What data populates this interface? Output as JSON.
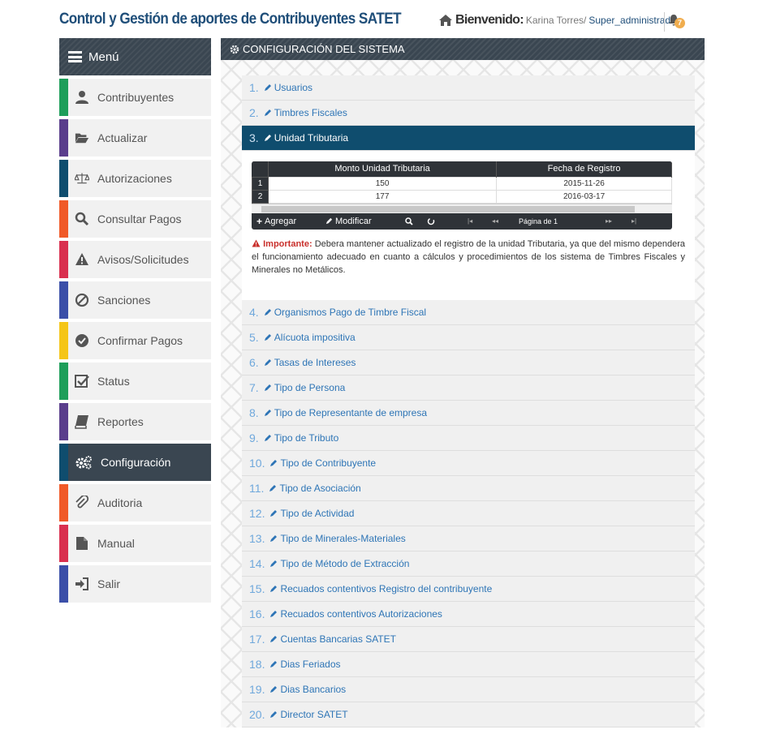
{
  "header": {
    "title": "Control y Gestión de aportes de Contribuyentes SATET",
    "welcome": "Bienvenido:",
    "user_name": "Karina Torres/",
    "role": "Super_administrador",
    "notification_count": "7"
  },
  "sidebar": {
    "menu_label": "Menú",
    "items": [
      {
        "label": "Contribuyentes",
        "color": "#1e9e5a",
        "icon": "user-icon"
      },
      {
        "label": "Actualizar",
        "color": "#5a3e8c",
        "icon": "folder-open-icon"
      },
      {
        "label": "Autorizaciones",
        "color": "#0f4d6e",
        "icon": "balance-scale-icon"
      },
      {
        "label": "Consultar Pagos",
        "color": "#f05a28",
        "icon": "search-icon"
      },
      {
        "label": "Avisos/Solicitudes",
        "color": "#d9304f",
        "icon": "warning-icon"
      },
      {
        "label": "Sanciones",
        "color": "#3b4fa8",
        "icon": "ban-icon"
      },
      {
        "label": "Confirmar Pagos",
        "color": "#f5c518",
        "icon": "check-circle-icon"
      },
      {
        "label": "Status",
        "color": "#1e9e5a",
        "icon": "check-square-icon"
      },
      {
        "label": "Reportes",
        "color": "#5a3e8c",
        "icon": "book-icon"
      },
      {
        "label": "Configuración",
        "color": "#0f4d6e",
        "icon": "cogs-icon",
        "active": true
      },
      {
        "label": "Auditoria",
        "color": "#f05a28",
        "icon": "paperclip-icon"
      },
      {
        "label": "Manual",
        "color": "#d9304f",
        "icon": "file-icon"
      },
      {
        "label": "Salir",
        "color": "#3b4fa8",
        "icon": "sign-in-icon"
      }
    ]
  },
  "main": {
    "title": "CONFIGURACIÓN DEL SISTEMA",
    "sections_before": [
      {
        "num": "1.",
        "label": "Usuarios"
      },
      {
        "num": "2.",
        "label": "Timbres Fiscales"
      }
    ],
    "active_section": {
      "num": "3.",
      "label": "Unidad Tributaria"
    },
    "grid": {
      "columns": [
        "Monto Unidad Tributaria",
        "Fecha de Registro"
      ],
      "rows": [
        {
          "n": "1",
          "monto": "150",
          "fecha": "2015-11-26"
        },
        {
          "n": "2",
          "monto": "177",
          "fecha": "2016-03-17"
        }
      ],
      "add_label": "Agregar",
      "edit_label": "Modificar",
      "pager_text": "Página  de 1"
    },
    "note": {
      "prefix": "Importante:",
      "text": " Debera mantener actualizado el registro de la unidad Tributaria, ya que del mismo dependera el funcionamiento adecuado en cuanto a cálculos y procedimientos de los sistema de Timbres Fiscales y Minerales no Metálicos."
    },
    "sections_after": [
      {
        "num": "4.",
        "label": "Organismos Pago de Timbre Fiscal"
      },
      {
        "num": "5.",
        "label": "Alícuota impositiva"
      },
      {
        "num": "6.",
        "label": "Tasas de Intereses"
      },
      {
        "num": "7.",
        "label": "Tipo de Persona"
      },
      {
        "num": "8.",
        "label": "Tipo de Representante de empresa"
      },
      {
        "num": "9.",
        "label": "Tipo de Tributo"
      },
      {
        "num": "10.",
        "label": "Tipo de Contribuyente"
      },
      {
        "num": "11.",
        "label": "Tipo de Asociación"
      },
      {
        "num": "12.",
        "label": "Tipo de Actividad"
      },
      {
        "num": "13.",
        "label": "Tipo de Minerales-Materiales"
      },
      {
        "num": "14.",
        "label": "Tipo de Método de Extracción"
      },
      {
        "num": "15.",
        "label": "Recuados contentivos Registro del contribuyente"
      },
      {
        "num": "16.",
        "label": "Recuados contentivos Autorizaciones"
      },
      {
        "num": "17.",
        "label": "Cuentas Bancarias SATET"
      },
      {
        "num": "18.",
        "label": "Dias Feriados"
      },
      {
        "num": "19.",
        "label": "Dias Bancarios"
      },
      {
        "num": "20.",
        "label": "Director SATET"
      }
    ]
  }
}
